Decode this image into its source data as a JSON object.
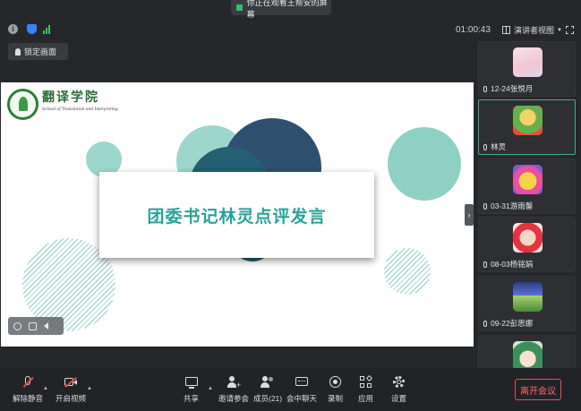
{
  "banner": {
    "text": "你正在观看王帮安的屏幕"
  },
  "status": {
    "timer": "01:00:43",
    "view_label": "演讲者视图"
  },
  "lock_button": {
    "label": "锁定画面"
  },
  "slide": {
    "school_cn": "翻译学院",
    "school_en": "School of Translation and Interpreting",
    "title": "团委书记林灵点评发言",
    "colors": {
      "teal": "#2aa29a",
      "navy": "#2f4f6e",
      "mint": "#8fd0c4"
    }
  },
  "participants": [
    {
      "name": "12-24张悦月",
      "avatar": "anime-girl-avatar"
    },
    {
      "name": "林灵",
      "avatar": "cartoon-boy-avatar",
      "active": true
    },
    {
      "name": "03-31游雨馨",
      "avatar": "pokemon-avatar"
    },
    {
      "name": "08-03杨铭娟",
      "avatar": "heart-dog-avatar"
    },
    {
      "name": "09-22彭思娜",
      "avatar": "pixel-character-avatar"
    },
    {
      "name": "",
      "avatar": "green-hair-avatar"
    }
  ],
  "toolbar": {
    "unmute": "解除静音",
    "start_video": "开启视频",
    "share": "共享",
    "invite": "邀请参会",
    "members": "成员(21)",
    "chat": "会中聊天",
    "record": "录制",
    "apps": "应用",
    "settings": "设置",
    "leave": "离开会议"
  }
}
